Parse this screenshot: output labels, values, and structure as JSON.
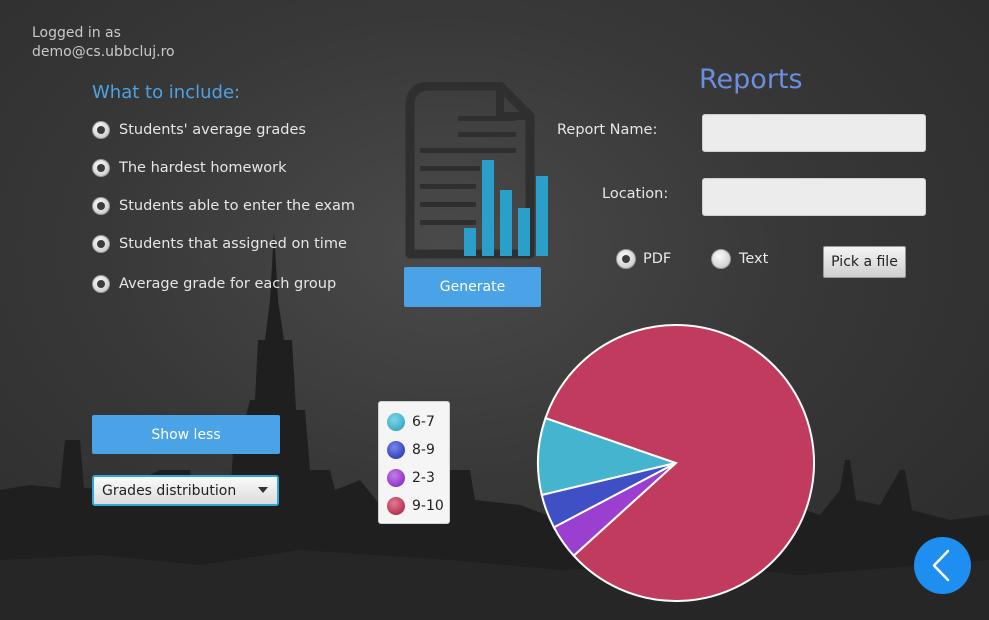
{
  "header": {
    "login_line1": "Logged in as",
    "login_line2": "demo@cs.ubbcluj.ro"
  },
  "include": {
    "title": "What to include:",
    "options": [
      {
        "label": "Students' average grades",
        "checked": true
      },
      {
        "label": "The hardest homework",
        "checked": true
      },
      {
        "label": "Students able to enter the exam",
        "checked": true
      },
      {
        "label": "Students that assigned on time",
        "checked": true
      },
      {
        "label": "Average grade for each group",
        "checked": true
      }
    ]
  },
  "generate_label": "Generate",
  "show_less_label": "Show less",
  "chart_select": {
    "value": "Grades distribution"
  },
  "reports": {
    "title": "Reports",
    "report_name_label": "Report Name:",
    "report_name_value": "",
    "location_label": "Location:",
    "location_value": "",
    "format_pdf_label": "PDF",
    "format_text_label": "Text",
    "format_selected": "PDF",
    "pick_file_label": "Pick a file"
  },
  "icons": {
    "document": "document-chart-icon",
    "back": "chevron-left-icon"
  },
  "colors": {
    "accent": "#4aa3e6",
    "reports_title": "#6a8fe0",
    "back_button": "#1e8ff0"
  },
  "chart_data": {
    "type": "pie",
    "title": "",
    "series": [
      {
        "name": "6-7",
        "value": 9,
        "color": "#45b5cf"
      },
      {
        "name": "8-9",
        "value": 4,
        "color": "#3f4fc4"
      },
      {
        "name": "2-3",
        "value": 4,
        "color": "#9a3fcf"
      },
      {
        "name": "9-10",
        "value": 83,
        "color": "#c13b5f"
      }
    ],
    "legend_position": "left"
  }
}
